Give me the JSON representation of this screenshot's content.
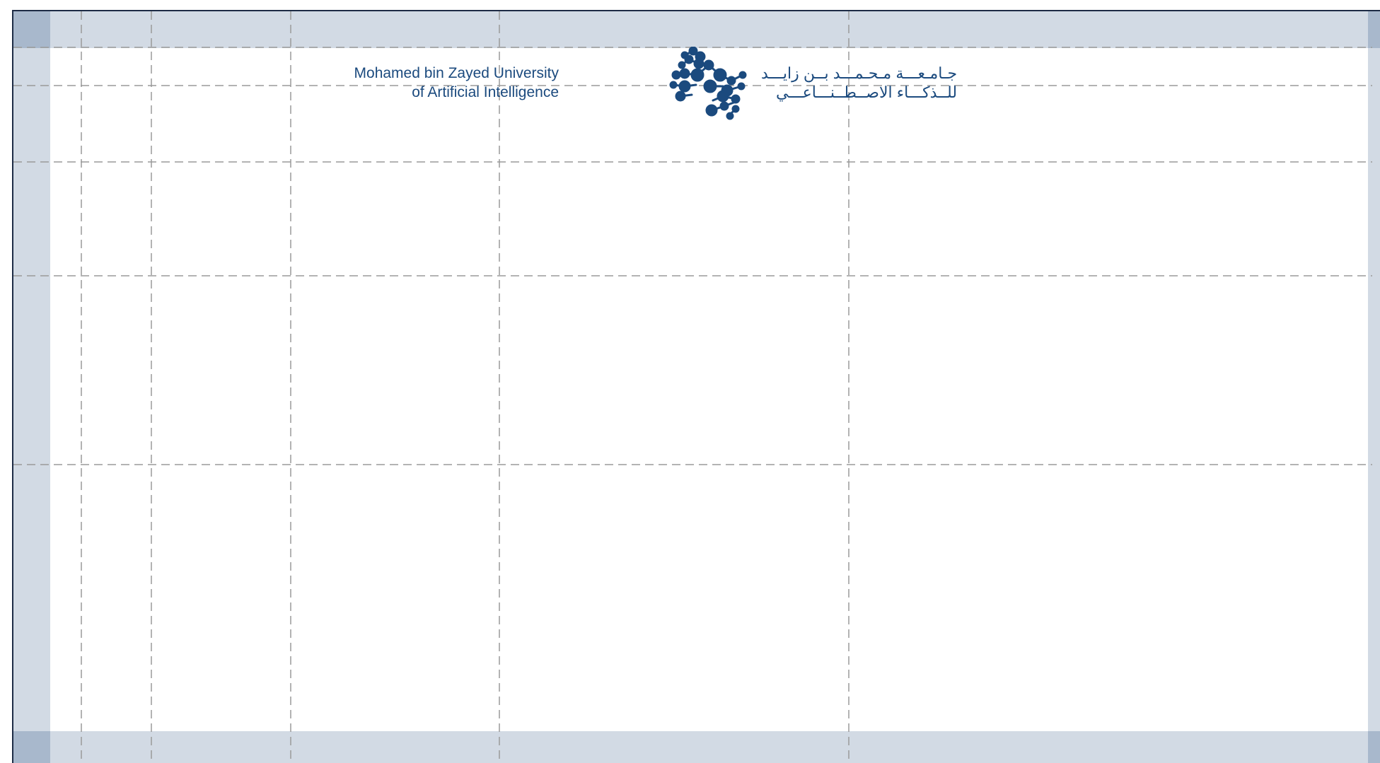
{
  "logo": {
    "english_line_1": "Mohamed bin Zayed University",
    "english_line_2": "of Artificial Intelligence",
    "arabic_line_1": "جـامـعـــة مـحـمـــد بــن زايـــد",
    "arabic_line_2": "للــذكـــاء الاصــطــنـــاعـــي",
    "mark_icon": "molecule-network-icon",
    "color": "#1b4a7e"
  },
  "colors": {
    "margin_band": "#d2dae4",
    "margin_corner": "#a8b8cc",
    "frame_border": "#1d2b45",
    "guide_line": "#9a9a9a",
    "page_background": "#ffffff"
  }
}
